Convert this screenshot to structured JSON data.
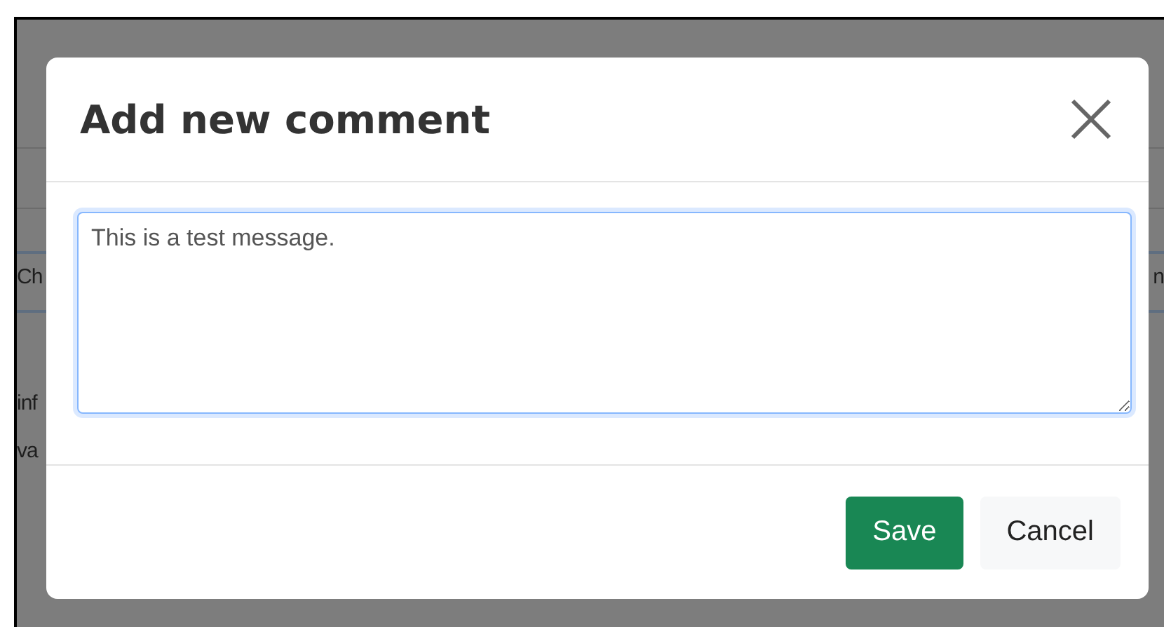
{
  "background": {
    "tab_left": "Ch",
    "tab_right": "n",
    "lines": [
      "inf",
      "va"
    ]
  },
  "dialog": {
    "title": "Add new comment",
    "comment": {
      "value": "This is a test message."
    },
    "buttons": [
      {
        "label": "Save",
        "kind": "primary"
      },
      {
        "label": "Cancel",
        "kind": "secondary"
      }
    ]
  }
}
